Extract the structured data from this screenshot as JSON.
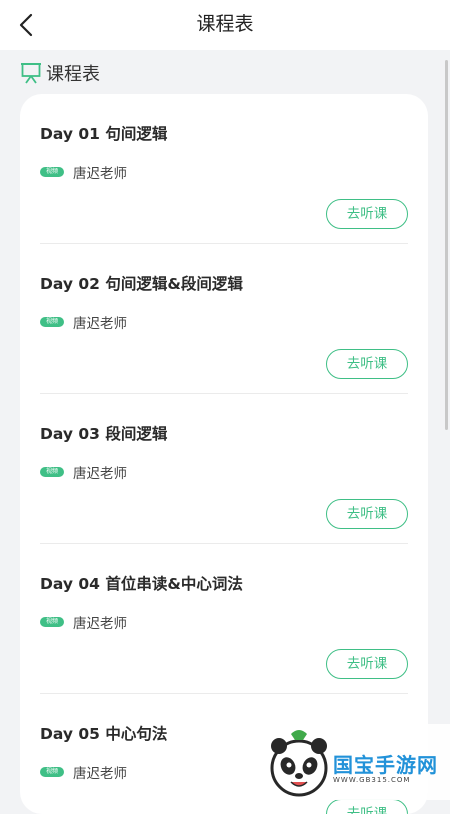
{
  "header": {
    "title": "课程表"
  },
  "section": {
    "title": "课程表"
  },
  "lessons": [
    {
      "title": "Day 01 句间逻辑",
      "tag": "视频",
      "teacher": "唐迟老师",
      "button": "去听课"
    },
    {
      "title": "Day 02 句间逻辑&段间逻辑",
      "tag": "视频",
      "teacher": "唐迟老师",
      "button": "去听课"
    },
    {
      "title": "Day 03 段间逻辑",
      "tag": "视频",
      "teacher": "唐迟老师",
      "button": "去听课"
    },
    {
      "title": "Day 04 首位串读&中心词法",
      "tag": "视频",
      "teacher": "唐迟老师",
      "button": "去听课"
    },
    {
      "title": "Day 05 中心句法",
      "tag": "视频",
      "teacher": "唐迟老师",
      "button": "去听课"
    }
  ],
  "watermark": {
    "text": "国宝手游网",
    "url": "WWW.GB315.COM"
  },
  "colors": {
    "accent": "#3fbf86",
    "page_bg": "#f2f3f5",
    "card_bg": "#ffffff"
  }
}
